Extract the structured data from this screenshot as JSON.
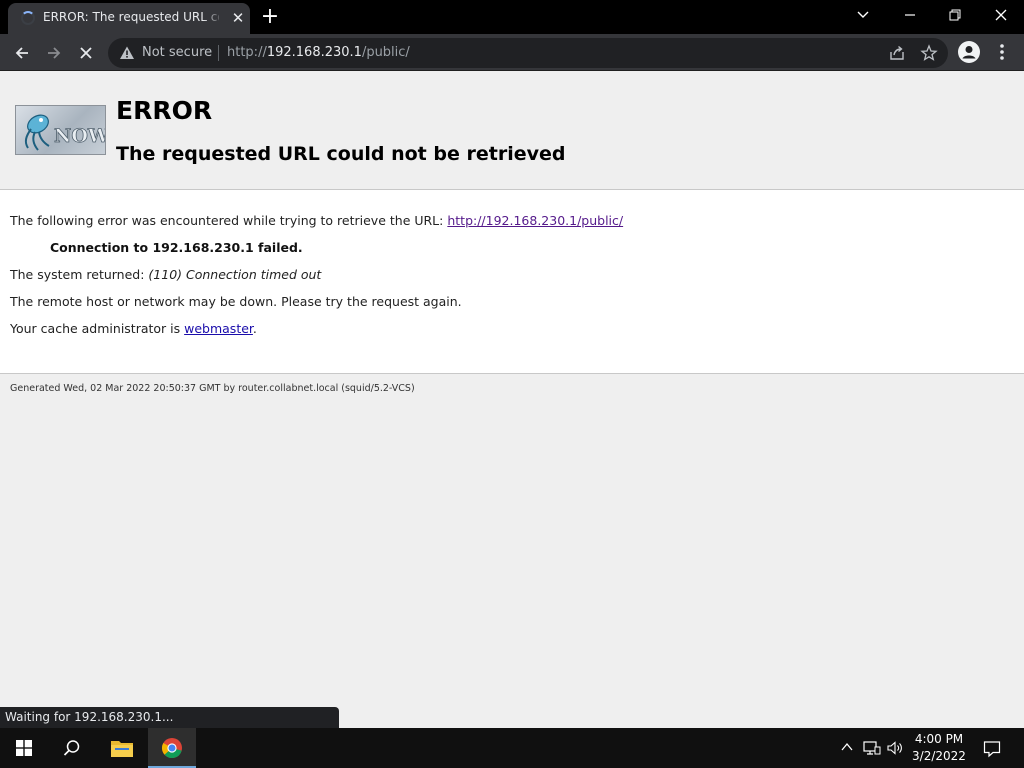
{
  "browser": {
    "tab_title": "ERROR: The requested URL could not be retrieved",
    "new_tab_label": "+",
    "security_label": "Not secure",
    "url_scheme": "http://",
    "url_host": "192.168.230.1",
    "url_path": "/public/",
    "status_text": "Waiting for 192.168.230.1..."
  },
  "page": {
    "logo_text": "NOW",
    "title": "ERROR",
    "subtitle": "The requested URL could not be retrieved",
    "intro_text": "The following error was encountered while trying to retrieve the URL: ",
    "intro_link": "http://192.168.230.1/public/",
    "failure": "Connection to 192.168.230.1 failed.",
    "system_returned_label": "The system returned: ",
    "system_returned_value": "(110) Connection timed out",
    "advice": "The remote host or network may be down. Please try the request again.",
    "admin_prefix": "Your cache administrator is ",
    "admin_link": "webmaster",
    "admin_suffix": ".",
    "footer": "Generated Wed, 02 Mar 2022 20:50:37 GMT by router.collabnet.local (squid/5.2-VCS)"
  },
  "taskbar": {
    "time": "4:00 PM",
    "date": "3/2/2022"
  },
  "icons": [
    "loading-spinner-icon",
    "close-icon",
    "back-arrow-icon",
    "forward-arrow-icon",
    "stop-icon",
    "warning-icon",
    "share-icon",
    "star-icon",
    "profile-icon",
    "menu-dots-icon",
    "windows-start-icon",
    "search-icon",
    "file-explorer-icon",
    "chrome-icon",
    "chevron-up-icon",
    "network-icon",
    "volume-icon",
    "notification-icon"
  ],
  "colors": {
    "chrome_dark": "#35363a",
    "omnibox": "#202124",
    "link": "#1a0dab",
    "visited_link": "#551a8b"
  }
}
